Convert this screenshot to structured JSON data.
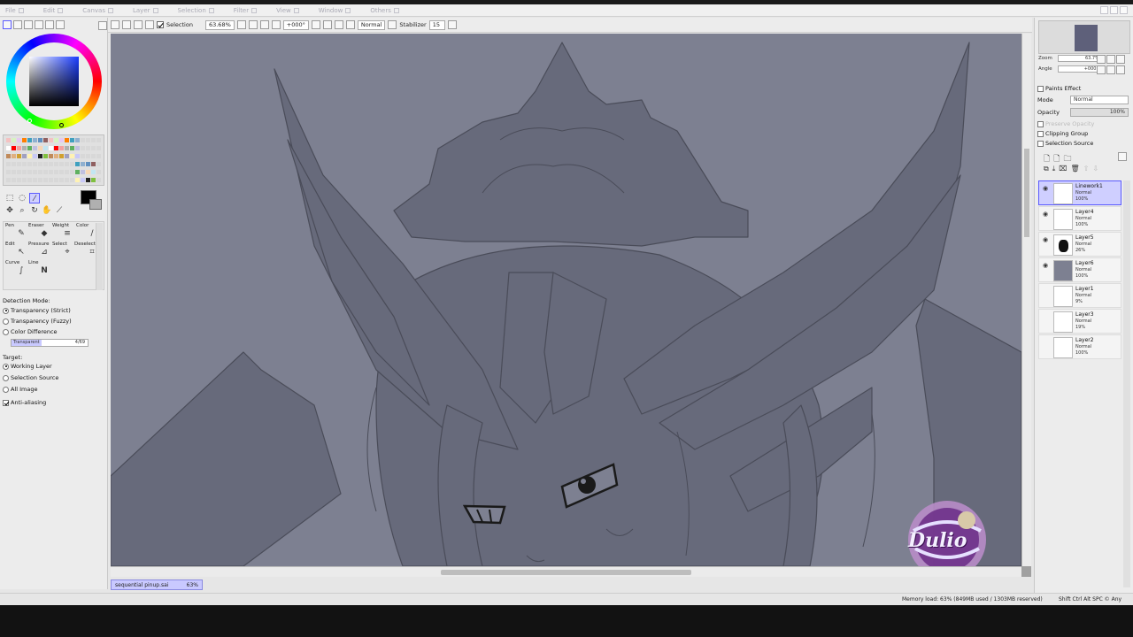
{
  "menubar": {
    "items": [
      "File",
      "Edit",
      "Canvas",
      "Layer",
      "Selection",
      "Filter",
      "View",
      "Window",
      "Others"
    ]
  },
  "toolbar": {
    "selection_label": "Selection",
    "zoom": "63.68%",
    "angle": "+000°",
    "blend_mode": "Normal",
    "stabilizer_label": "Stabilizer",
    "stabilizer_value": "15"
  },
  "left_panel": {
    "tool_labels": {
      "pen": "Pen",
      "eraser": "Eraser",
      "weight": "Weight",
      "color": "Color",
      "edit": "Edit",
      "pressure": "Pressure",
      "select": "Select",
      "deselect": "Deselect",
      "curve": "Curve",
      "line": "Line"
    },
    "detection_mode_label": "Detection Mode:",
    "detection_modes": [
      "Transparency (Strict)",
      "Transparency (Fuzzy)",
      "Color Difference"
    ],
    "transparency_label": "Transparent",
    "transparency_value": "4/69",
    "target_label": "Target:",
    "targets": [
      "Working Layer",
      "Selection Source",
      "All Image"
    ],
    "antialiasing_label": "Anti-aliasing"
  },
  "right_panel": {
    "zoom_label": "Zoom",
    "zoom_value": "63.7%",
    "angle_label": "Angle",
    "angle_value": "+000$",
    "paints_effect": "Paints Effect",
    "mode_label": "Mode",
    "mode_value": "Normal",
    "opacity_label": "Opacity",
    "opacity_value": "100%",
    "preserve_opacity": "Preserve Opacity",
    "clipping_group": "Clipping Group",
    "selection_source": "Selection Source",
    "layers": [
      {
        "name": "Linework1",
        "mode": "Normal",
        "opacity": "100%"
      },
      {
        "name": "Layer4",
        "mode": "Normal",
        "opacity": "100%"
      },
      {
        "name": "Layer5",
        "mode": "Normal",
        "opacity": "26%"
      },
      {
        "name": "Layer6",
        "mode": "Normal",
        "opacity": "100%"
      },
      {
        "name": "Layer1",
        "mode": "Normal",
        "opacity": "9%"
      },
      {
        "name": "Layer3",
        "mode": "Normal",
        "opacity": "19%"
      },
      {
        "name": "Layer2",
        "mode": "Normal",
        "opacity": "100%"
      }
    ]
  },
  "file_tab": {
    "name": "sequential pinup.sai",
    "zoom": "63%"
  },
  "status": {
    "memory": "Memory load: 63% (849MB used / 1303MB reserved)",
    "keys": "Shift Ctrl Alt SPC © Any"
  },
  "watermark_text": "Dulio",
  "colors": {
    "canvas_bg": "#7d8091",
    "line_art": "#4a4c59",
    "selection_accent": "#5a5aff"
  }
}
